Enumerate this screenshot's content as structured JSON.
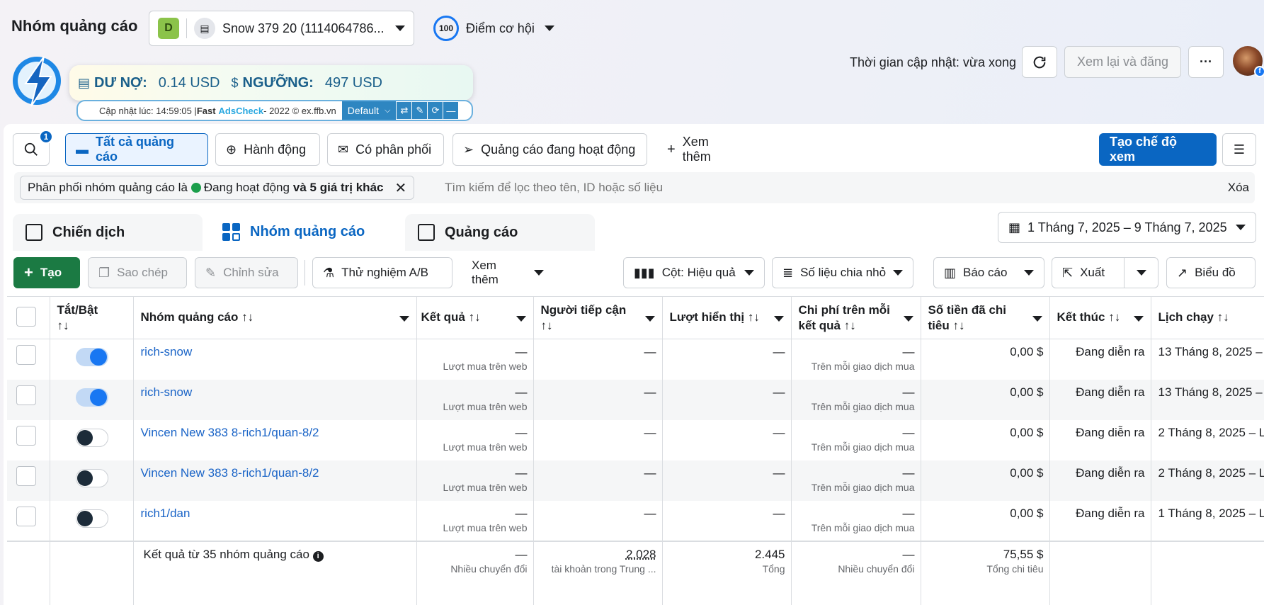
{
  "header": {
    "title": "Nhóm quảng cáo",
    "account_badge": "D",
    "account_name": "Snow 379 20 (1114064786...",
    "score_value": "100",
    "score_label": "Điểm cơ hội",
    "update_text": "Thời gian cập nhật: vừa xong",
    "review_button": "Xem lại và đăng",
    "more_button": "···"
  },
  "adscheck": {
    "debt_label": "DƯ NỢ:",
    "debt_value": "0.14 USD",
    "threshold_label": "NGƯỠNG:",
    "threshold_value": "497 USD",
    "updated_prefix": "Cập nhật lúc: 14:59:05 | ",
    "brand_fast": "Fast",
    "brand_ads": "AdsCheck",
    "brand_suffix": " - 2022 © ex.ffb.vn",
    "preset": "Default"
  },
  "toolbar": {
    "search_badge": "1",
    "all_ads": "Tất cả quảng cáo",
    "actions": "Hành động",
    "delivering": "Có phân phối",
    "active_ads": "Quảng cáo đang hoạt động",
    "see_more": "Xem thêm",
    "create_view": "Tạo chế độ xem"
  },
  "filter": {
    "chip_prefix": "Phân phối nhóm quảng cáo là",
    "chip_status": "Đang hoạt động",
    "chip_more": "và 5 giá trị khác",
    "search_placeholder": "Tìm kiếm để lọc theo tên, ID hoặc số liệu",
    "clear": "Xóa"
  },
  "tabs": [
    {
      "label": "Chiến dịch"
    },
    {
      "label": "Nhóm quảng cáo"
    },
    {
      "label": "Quảng cáo"
    }
  ],
  "date_range": "1 Tháng 7, 2025 – 9 Tháng 7, 2025",
  "actions": {
    "create": "Tạo",
    "duplicate": "Sao chép",
    "edit": "Chỉnh sửa",
    "ab_test": "Thử nghiệm A/B",
    "see_more": "Xem thêm",
    "columns": "Cột: Hiệu quả",
    "breakdown": "Số liệu chia nhỏ",
    "reports": "Báo cáo",
    "export": "Xuất",
    "charts": "Biểu đồ"
  },
  "columns": [
    "Tắt/Bật",
    "Nhóm quảng cáo",
    "Kết quả",
    "Người tiếp cận",
    "Lượt hiển thị",
    "Chi phí trên mỗi kết quả",
    "Số tiền đã chi tiêu",
    "Kết thúc",
    "Lịch chạy"
  ],
  "sort_glyph": "↑↓",
  "rows": [
    {
      "on": true,
      "name": "rich-snow",
      "result": "—",
      "result_sub": "Lượt mua trên web",
      "reach": "—",
      "impressions": "—",
      "cpr": "—",
      "cpr_sub": "Trên mỗi giao dịch mua",
      "spent": "0,00 $",
      "end": "Đang diễn ra",
      "schedule": "13 Tháng 8, 2025 –"
    },
    {
      "on": true,
      "name": "rich-snow",
      "result": "—",
      "result_sub": "Lượt mua trên web",
      "reach": "—",
      "impressions": "—",
      "cpr": "—",
      "cpr_sub": "Trên mỗi giao dịch mua",
      "spent": "0,00 $",
      "end": "Đang diễn ra",
      "schedule": "13 Tháng 8, 2025 –"
    },
    {
      "on": false,
      "name": "Vincen New 383 8-rich1/quan-8/2",
      "result": "—",
      "result_sub": "Lượt mua trên web",
      "reach": "—",
      "impressions": "—",
      "cpr": "—",
      "cpr_sub": "Trên mỗi giao dịch mua",
      "spent": "0,00 $",
      "end": "Đang diễn ra",
      "schedule": "2 Tháng 8, 2025 – L"
    },
    {
      "on": false,
      "name": "Vincen New 383 8-rich1/quan-8/2",
      "result": "—",
      "result_sub": "Lượt mua trên web",
      "reach": "—",
      "impressions": "—",
      "cpr": "—",
      "cpr_sub": "Trên mỗi giao dịch mua",
      "spent": "0,00 $",
      "end": "Đang diễn ra",
      "schedule": "2 Tháng 8, 2025 – L"
    },
    {
      "on": false,
      "name": "rich1/dan",
      "result": "—",
      "result_sub": "Lượt mua trên web",
      "reach": "—",
      "impressions": "—",
      "cpr": "—",
      "cpr_sub": "Trên mỗi giao dịch mua",
      "spent": "0,00 $",
      "end": "Đang diễn ra",
      "schedule": "1 Tháng 8, 2025 – L"
    }
  ],
  "summary": {
    "label": "Kết quả từ 35 nhóm quảng cáo",
    "result": "—",
    "result_sub": "Nhiều chuyển đổi",
    "reach": "2.028",
    "reach_sub": "tài khoản trong Trung ...",
    "impressions": "2.445",
    "impressions_sub": "Tổng",
    "cpr": "—",
    "cpr_sub": "Nhiều chuyển đổi",
    "spent": "75,55 $",
    "spent_sub": "Tổng chi tiêu"
  },
  "colors": {
    "primary": "#0a66c2",
    "create_green": "#1b7a43",
    "link": "#1a64c7"
  }
}
